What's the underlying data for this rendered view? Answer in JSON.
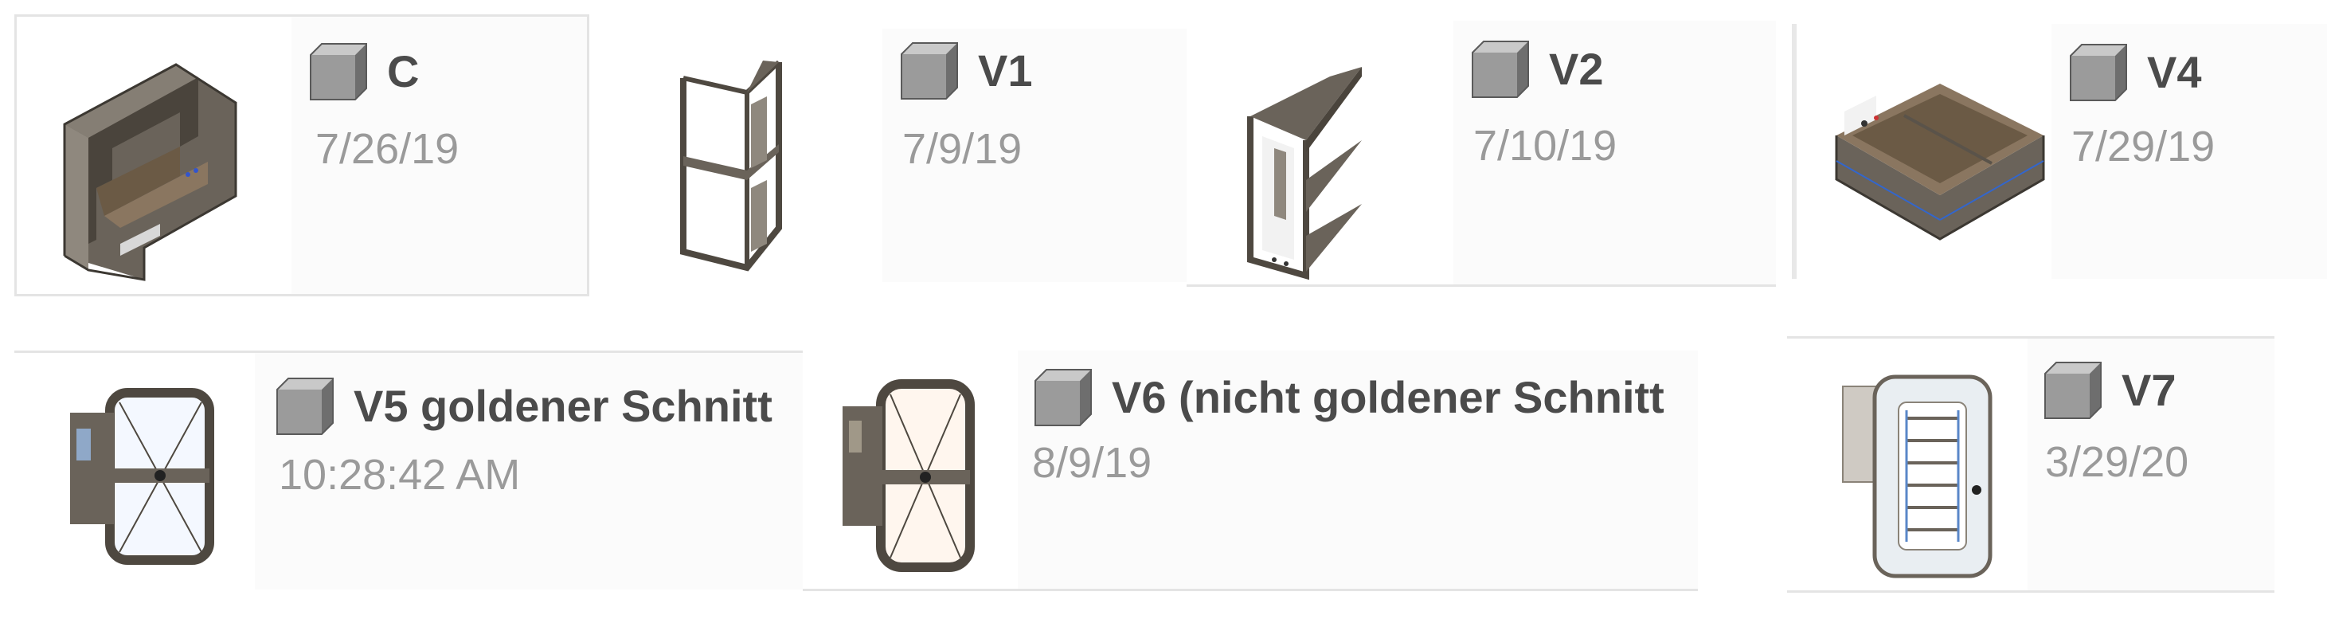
{
  "designs": [
    {
      "name": "C",
      "date": "7/26/19"
    },
    {
      "name": "V1",
      "date": "7/9/19"
    },
    {
      "name": "V2",
      "date": "7/10/19"
    },
    {
      "name": "V4",
      "date": "7/29/19"
    },
    {
      "name": "V5 goldener Schnitt",
      "date": "10:28:42 AM"
    },
    {
      "name": "V6 (nicht goldener Schnitt",
      "date": "8/9/19"
    },
    {
      "name": "V7",
      "date": "3/29/20"
    }
  ],
  "icons": {
    "design_type": "3d-model-cube-icon"
  },
  "colors": {
    "title": "#4b4b4b",
    "date": "#9a9a9a",
    "model": "#5e574e"
  }
}
